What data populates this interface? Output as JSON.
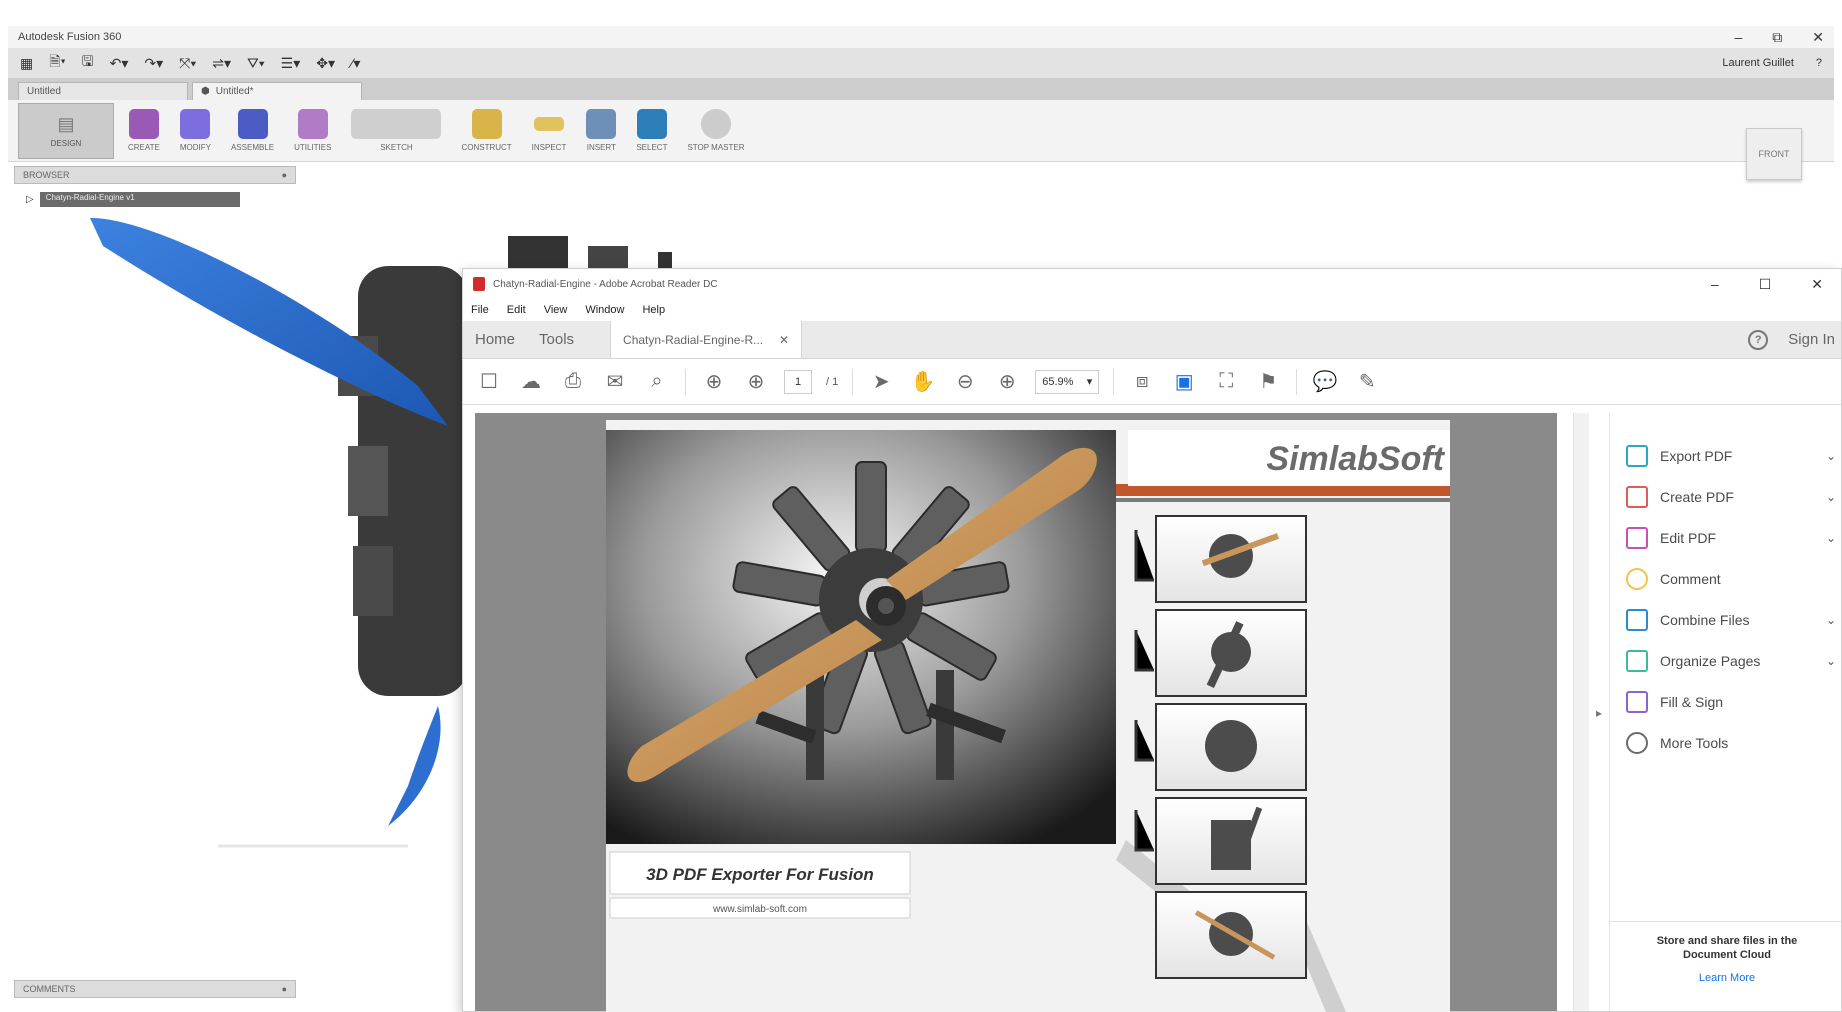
{
  "fusion": {
    "title": "Autodesk Fusion 360",
    "user": "Laurent Guillet",
    "help": "?",
    "qat_icons": [
      "grid-icon",
      "file-icon",
      "save-icon",
      "undo-icon",
      "redo-icon"
    ],
    "tabs": [
      {
        "label": "Untitled"
      },
      {
        "label": "Untitled*"
      }
    ],
    "workspace": "DESIGN",
    "ribbon": [
      {
        "label": "CREATE",
        "color": "#8e44ad"
      },
      {
        "label": "MODIFY",
        "color": "#6c5ce7"
      },
      {
        "label": "ASSEMBLE",
        "color": "#3f51b5"
      },
      {
        "label": "UTILITIES",
        "color": "#9b59b6"
      },
      {
        "label": "SKETCH",
        "color": "#555555"
      },
      {
        "label": "CONSTRUCT",
        "color": "#d4a017"
      },
      {
        "label": "INSPECT",
        "color": "#c9a227"
      },
      {
        "label": "INSERT",
        "color": "#4a6fa5"
      },
      {
        "label": "SELECT",
        "color": "#2c7fb8"
      },
      {
        "label": "STOP MASTER",
        "color": "#888888"
      }
    ],
    "viewcube": "FRONT",
    "browser": "BROWSER",
    "browser_item": "Chatyn-Radial-Engine v1",
    "comments": "COMMENTS"
  },
  "acrobat": {
    "title": "Chatyn-Radial-Engine - Adobe Acrobat Reader DC",
    "menu": [
      "File",
      "Edit",
      "View",
      "Window",
      "Help"
    ],
    "tab_home": "Home",
    "tab_tools": "Tools",
    "tab_doc": "Chatyn-Radial-Engine-R...",
    "sign_in": "Sign In",
    "page_current": "1",
    "page_total": "/ 1",
    "zoom": "65.9%",
    "tools": [
      {
        "label": "Export PDF",
        "color": "#2aa7c9",
        "chevron": true
      },
      {
        "label": "Create PDF",
        "color": "#e05a5a",
        "chevron": true
      },
      {
        "label": "Edit PDF",
        "color": "#c94fb0",
        "chevron": true
      },
      {
        "label": "Comment",
        "color": "#f2c14e",
        "chevron": false
      },
      {
        "label": "Combine Files",
        "color": "#2a8ad6",
        "chevron": true
      },
      {
        "label": "Organize Pages",
        "color": "#3fb7a5",
        "chevron": true
      },
      {
        "label": "Fill & Sign",
        "color": "#8e63ce",
        "chevron": false
      },
      {
        "label": "More Tools",
        "color": "#6a6a6a",
        "chevron": false
      }
    ],
    "footer_text": "Store and share files in the Document Cloud",
    "footer_link": "Learn More"
  },
  "pdf": {
    "logo": "SimlabSoft",
    "caption": "3D PDF Exporter For Fusion",
    "url": "www.simlab-soft.com",
    "colors": {
      "propeller": "#c8955c",
      "blue_blade": "#2c6fd1",
      "stripe": "#c0582b"
    }
  }
}
